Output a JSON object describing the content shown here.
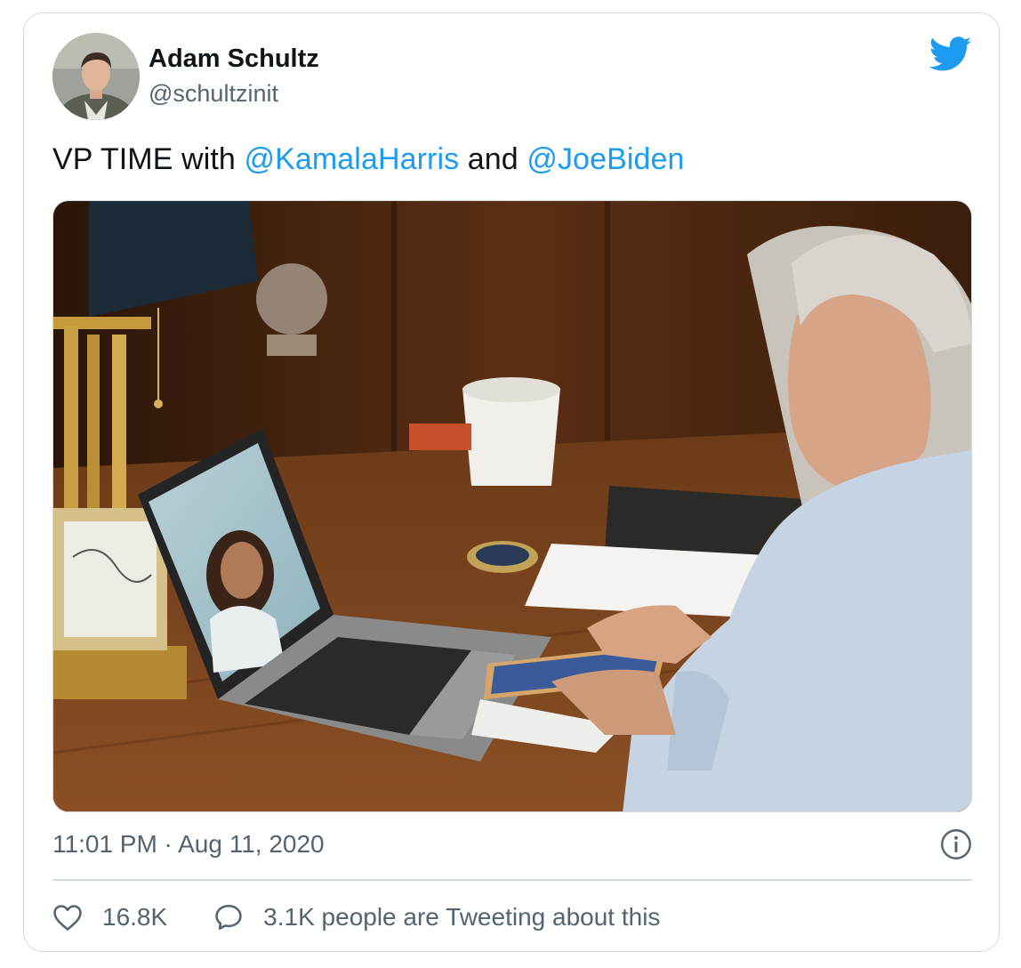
{
  "author": {
    "name": "Adam Schultz",
    "handle": "@schultzinit"
  },
  "tweet": {
    "text_prefix": "VP TIME with ",
    "mention_1": "@KamalaHarris",
    "text_middle": " and ",
    "mention_2": "@JoeBiden"
  },
  "timestamp": "11:01 PM · Aug 11, 2020",
  "actions": {
    "likes": "16.8K",
    "tweeting": "3.1K people are Tweeting about this"
  },
  "icons": {
    "brand": "twitter-bird-icon",
    "info": "info-icon",
    "like": "heart-icon",
    "reply": "speech-bubble-icon"
  },
  "colors": {
    "accent": "#1d9bf0",
    "text": "#0f1419",
    "secondary": "#536471",
    "border": "#cfd9de"
  }
}
